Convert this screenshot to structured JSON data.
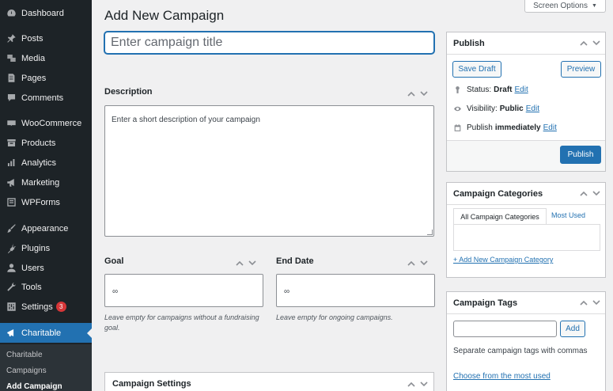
{
  "sidebar": {
    "items": [
      {
        "label": "Dashboard",
        "icon": "dashboard-icon"
      },
      {
        "label": "Posts",
        "icon": "pin-icon"
      },
      {
        "label": "Media",
        "icon": "media-icon"
      },
      {
        "label": "Pages",
        "icon": "pages-icon"
      },
      {
        "label": "Comments",
        "icon": "comment-icon"
      },
      {
        "label": "WooCommerce",
        "icon": "woocommerce-icon"
      },
      {
        "label": "Products",
        "icon": "archive-icon"
      },
      {
        "label": "Analytics",
        "icon": "bar-chart-icon"
      },
      {
        "label": "Marketing",
        "icon": "megaphone-icon"
      },
      {
        "label": "WPForms",
        "icon": "form-icon"
      },
      {
        "label": "Appearance",
        "icon": "paintbrush-icon"
      },
      {
        "label": "Plugins",
        "icon": "plugin-icon"
      },
      {
        "label": "Users",
        "icon": "user-icon"
      },
      {
        "label": "Tools",
        "icon": "wrench-icon"
      },
      {
        "label": "Settings",
        "icon": "settings-icon",
        "badge": "3"
      },
      {
        "label": "Charitable",
        "icon": "charitable-icon"
      }
    ],
    "submenu": [
      "Charitable",
      "Campaigns",
      "Add Campaign"
    ]
  },
  "header": {
    "title": "Add New Campaign",
    "screen_options": "Screen Options"
  },
  "main": {
    "title_placeholder": "Enter campaign title",
    "description_label": "Description",
    "description_text": "Enter a short description of your campaign",
    "goal_label": "Goal",
    "goal_value": "∞",
    "goal_help": "Leave empty for campaigns without a fundraising goal.",
    "end_date_label": "End Date",
    "end_date_value": "∞",
    "end_date_help": "Leave empty for ongoing campaigns.",
    "settings_label": "Campaign Settings"
  },
  "publish": {
    "title": "Publish",
    "save_draft": "Save Draft",
    "preview": "Preview",
    "status_label": "Status:",
    "status_value": "Draft",
    "visibility_label": "Visibility:",
    "visibility_value": "Public",
    "schedule_label": "Publish",
    "schedule_value": "immediately",
    "edit": "Edit",
    "publish_button": "Publish"
  },
  "categories": {
    "title": "Campaign Categories",
    "tab_all": "All Campaign Categories",
    "tab_most_used": "Most Used",
    "add_new": "+ Add New Campaign Category"
  },
  "tags": {
    "title": "Campaign Tags",
    "add_button": "Add",
    "help": "Separate campaign tags with commas",
    "choose": "Choose from the most used"
  },
  "colors": {
    "sidebar_bg": "#1d2327",
    "accent": "#2271b1",
    "badge": "#d63638"
  }
}
